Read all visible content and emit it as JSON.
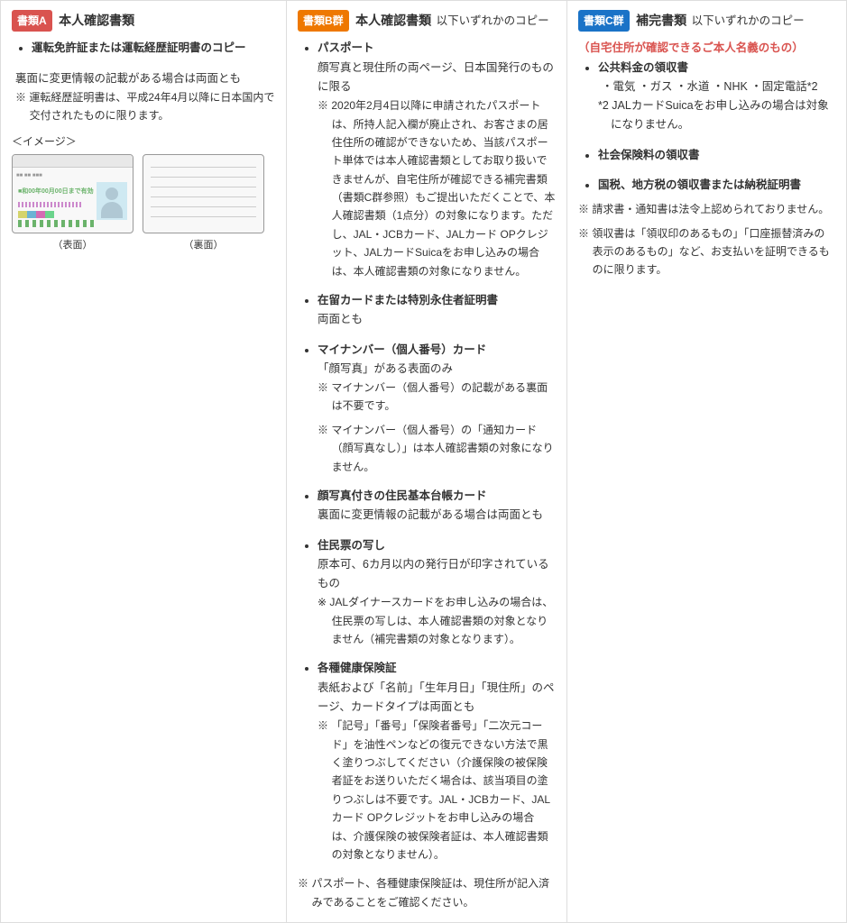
{
  "colA": {
    "badge": "書類A",
    "title": "本人確認書類",
    "items": [
      {
        "title": "運転免許証または運転経歴証明書のコピー",
        "desc": "裏面に変更情報の記載がある場合は両面とも",
        "notes": [
          "運転経歴証明書は、平成24年4月以降に日本国内で交付されたものに限ります。"
        ]
      }
    ],
    "imageLabel": "＜イメージ＞",
    "frontCaption": "（表面）",
    "backCaption": "（裏面）"
  },
  "colB": {
    "badge": "書類B群",
    "title": "本人確認書類",
    "subtitle": "以下いずれかのコピー",
    "items": [
      {
        "title": "パスポート",
        "desc": "顔写真と現住所の両ページ、日本国発行のものに限る",
        "notes": [
          "2020年2月4日以降に申請されたパスポートは、所持人記入欄が廃止され、お客さまの居住住所の確認ができないため、当該パスポート単体では本人確認書類としてお取り扱いできませんが、自宅住所が確認できる補完書類（書類C群参照）もご提出いただくことで、本人確認書類（1点分）の対象になります。ただし、JAL・JCBカード、JALカード OPクレジット、JALカードSuicaをお申し込みの場合は、本人確認書類の対象になりません。"
        ]
      },
      {
        "title": "在留カードまたは特別永住者証明書",
        "desc": "両面とも"
      },
      {
        "title": "マイナンバー（個人番号）カード",
        "desc": "「顔写真」がある表面のみ",
        "notes": [
          "マイナンバー（個人番号）の記載がある裏面は不要です。",
          "マイナンバー（個人番号）の「通知カード（顔写真なし）」は本人確認書類の対象になりません。"
        ]
      },
      {
        "title": "顔写真付きの住民基本台帳カード",
        "desc": "裏面に変更情報の記載がある場合は両面とも"
      },
      {
        "title": "住民票の写し",
        "desc": "原本可、6カ月以内の発行日が印字されているもの",
        "notes": [
          "JALダイナースカードをお申し込みの場合は、住民票の写しは、本人確認書類の対象となりません（補完書類の対象となります）。"
        ]
      },
      {
        "title": "各種健康保険証",
        "desc": "表紙および「名前」「生年月日」「現住所」のページ、カードタイプは両面とも",
        "notes": [
          "「記号」「番号」「保険者番号」「二次元コード」を油性ペンなどの復元できない方法で黒く塗りつぶしてください（介護保険の被保険者証をお送りいただく場合は、該当項目の塗りつぶしは不要です。JAL・JCBカード、JALカード OPクレジットをお申し込みの場合は、介護保険の被保険者証は、本人確認書類の対象となりません）。"
        ]
      }
    ],
    "bottomNote": "パスポート、各種健康保険証は、現住所が記入済みであることをご確認ください。"
  },
  "colC": {
    "badge": "書類C群",
    "title": "補完書類",
    "subtitle": "以下いずれかのコピー",
    "redNote": "（自宅住所が確認できるご本人名義のもの）",
    "items": [
      {
        "title": "公共料金の領収書",
        "bullets": "・電気 ・ガス ・水道 ・NHK ・固定電話*2",
        "footnote": "*2 JALカードSuicaをお申し込みの場合は対象になりません。"
      },
      {
        "title": "社会保険料の領収書"
      },
      {
        "title": "国税、地方税の領収書または納税証明書"
      }
    ],
    "outerNotes": [
      "請求書・通知書は法令上認められておりません。",
      "領収書は「領収印のあるもの」「口座振替済みの表示のあるもの」など、お支払いを証明できるものに限ります。"
    ]
  }
}
